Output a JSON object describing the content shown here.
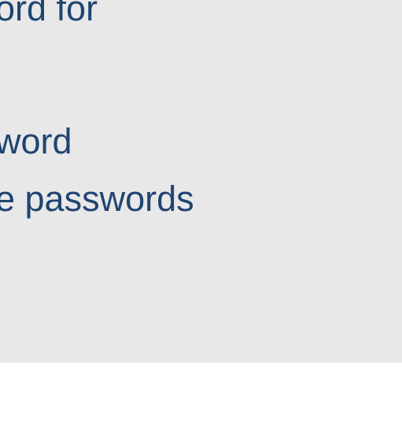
{
  "menu": {
    "items": [
      {
        "label": "ord for"
      },
      {
        "label": "word"
      },
      {
        "label": "e passwords"
      }
    ]
  },
  "colors": {
    "panel_background": "#e8e8e8",
    "link_text": "#1f4472",
    "page_background": "#ffffff"
  }
}
